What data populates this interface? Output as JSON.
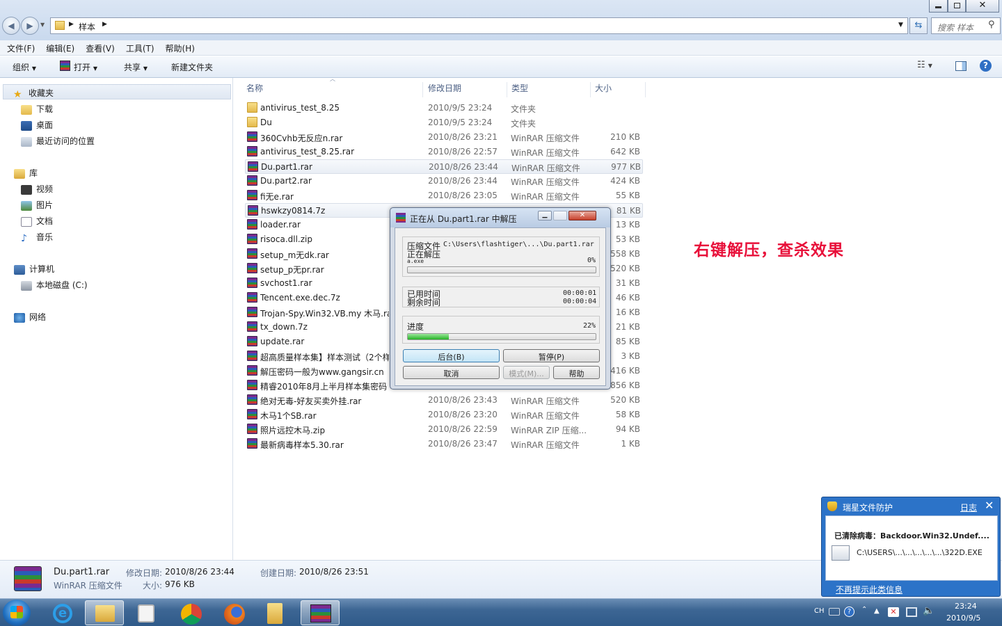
{
  "window": {
    "breadcrumb": "样本",
    "search_placeholder": "搜索 样本"
  },
  "menu": [
    "文件(F)",
    "编辑(E)",
    "查看(V)",
    "工具(T)",
    "帮助(H)"
  ],
  "toolbar": {
    "organize": "组织",
    "open": "打开",
    "share": "共享",
    "new_folder": "新建文件夹"
  },
  "nav": {
    "favorites": "收藏夹",
    "fav_items": [
      "下载",
      "桌面",
      "最近访问的位置"
    ],
    "libraries": "库",
    "lib_items": [
      "视频",
      "图片",
      "文档",
      "音乐"
    ],
    "computer": "计算机",
    "comp_items": [
      "本地磁盘 (C:)"
    ],
    "network": "网络"
  },
  "columns": {
    "name": "名称",
    "date": "修改日期",
    "type": "类型",
    "size": "大小"
  },
  "files": [
    {
      "name": "antivirus_test_8.25",
      "date": "2010/9/5 23:24",
      "type": "文件夹",
      "size": "",
      "kind": "folder"
    },
    {
      "name": "Du",
      "date": "2010/9/5 23:24",
      "type": "文件夹",
      "size": "",
      "kind": "folder"
    },
    {
      "name": "360Cvhb无反应n.rar",
      "date": "2010/8/26 23:21",
      "type": "WinRAR 压缩文件",
      "size": "210 KB",
      "kind": "rar"
    },
    {
      "name": "antivirus_test_8.25.rar",
      "date": "2010/8/26 22:57",
      "type": "WinRAR 压缩文件",
      "size": "642 KB",
      "kind": "rar"
    },
    {
      "name": "Du.part1.rar",
      "date": "2010/8/26 23:44",
      "type": "WinRAR 压缩文件",
      "size": "977 KB",
      "kind": "rar",
      "selected": true
    },
    {
      "name": "Du.part2.rar",
      "date": "2010/8/26 23:44",
      "type": "WinRAR 压缩文件",
      "size": "424 KB",
      "kind": "rar"
    },
    {
      "name": "fi无e.rar",
      "date": "2010/8/26 23:05",
      "type": "WinRAR 压缩文件",
      "size": "55 KB",
      "kind": "rar"
    },
    {
      "name": "hswkzy0814.7z",
      "date": "",
      "type": "",
      "size": "81 KB",
      "kind": "rar",
      "selected": true
    },
    {
      "name": "loader.rar",
      "date": "",
      "type": "",
      "size": "13 KB",
      "kind": "rar"
    },
    {
      "name": "risoca.dll.zip",
      "date": "",
      "type": "",
      "size": "53 KB",
      "kind": "rar"
    },
    {
      "name": "setup_m无dk.rar",
      "date": "",
      "type": "",
      "size": "558 KB",
      "kind": "rar"
    },
    {
      "name": "setup_p无pr.rar",
      "date": "",
      "type": "",
      "size": "520 KB",
      "kind": "rar"
    },
    {
      "name": "svchost1.rar",
      "date": "",
      "type": "",
      "size": "31 KB",
      "kind": "rar"
    },
    {
      "name": "Tencent.exe.dec.7z",
      "date": "",
      "type": "",
      "size": "46 KB",
      "kind": "rar"
    },
    {
      "name": "Trojan-Spy.Win32.VB.my 木马.rar",
      "date": "",
      "type": "",
      "size": "16 KB",
      "kind": "rar"
    },
    {
      "name": "tx_down.7z",
      "date": "",
      "type": "",
      "size": "21 KB",
      "kind": "rar"
    },
    {
      "name": "update.rar",
      "date": "",
      "type": "",
      "size": "85 KB",
      "kind": "rar"
    },
    {
      "name": "超高质量样本集】样本测试（2个样",
      "date": "",
      "type": "",
      "size": "3 KB",
      "kind": "rar"
    },
    {
      "name": "解压密码一般为www.gangsir.cn",
      "date": "",
      "type": "",
      "size": "416 KB",
      "kind": "rar"
    },
    {
      "name": "精睿2010年8月上半月样本集密码",
      "date": "",
      "type": "",
      "size": "856 KB",
      "kind": "rar"
    },
    {
      "name": "绝对无毒-好友买卖外挂.rar",
      "date": "2010/8/26 23:43",
      "type": "WinRAR 压缩文件",
      "size": "520 KB",
      "kind": "rar"
    },
    {
      "name": "木马1个SB.rar",
      "date": "2010/8/26 23:20",
      "type": "WinRAR 压缩文件",
      "size": "58 KB",
      "kind": "rar"
    },
    {
      "name": "照片远控木马.zip",
      "date": "2010/8/26 22:59",
      "type": "WinRAR ZIP 压缩...",
      "size": "94 KB",
      "kind": "rar"
    },
    {
      "name": "最新病毒样本5.30.rar",
      "date": "2010/8/26 23:47",
      "type": "WinRAR 压缩文件",
      "size": "1 KB",
      "kind": "rar"
    }
  ],
  "dialog": {
    "title": "正在从 Du.part1.rar 中解压",
    "archive_label": "压缩文件",
    "archive_path": "C:\\Users\\flashtiger\\...\\Du.part1.rar",
    "extracting_label": "正在解压",
    "current_file": "a.exe",
    "file_percent_text": "0%",
    "file_progress": 0,
    "elapsed_label": "已用时间",
    "elapsed": "00:00:01",
    "remaining_label": "剩余时间",
    "remaining": "00:00:04",
    "progress_label": "进度",
    "total_percent_text": "22%",
    "total_progress": 0.22,
    "btn_background": "后台(B)",
    "btn_pause": "暂停(P)",
    "btn_cancel": "取消",
    "btn_mode": "模式(M)...",
    "btn_help": "帮助"
  },
  "annotation": "右键解压，查杀效果",
  "status": {
    "filename": "Du.part1.rar",
    "filetype": "WinRAR 压缩文件",
    "modified_label": "修改日期:",
    "modified": "2010/8/26 23:44",
    "size_label": "大小:",
    "size": "976 KB",
    "created_label": "创建日期:",
    "created": "2010/8/26 23:51"
  },
  "popup": {
    "title": "瑞星文件防护",
    "log_link": "日志",
    "message": "已清除病毒：Backdoor.Win32.Undef....",
    "path": "C:\\USERS\\...\\...\\...\\...\\...\\322D.EXE",
    "dont_show": "不再提示此类信息"
  },
  "tray": {
    "lang": "CH",
    "time": "23:24",
    "date": "2010/9/5"
  },
  "colors": {
    "accent": "#2c73c8",
    "annotation": "#e8103a",
    "progress": "#26b226"
  }
}
